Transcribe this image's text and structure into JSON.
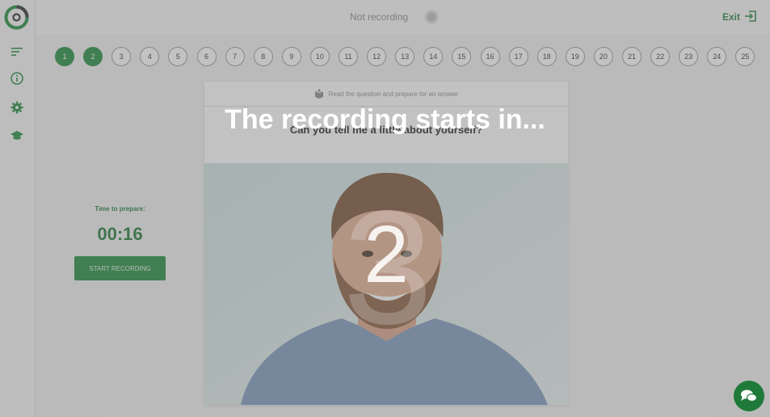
{
  "topbar": {
    "status": "Not recording",
    "exit_label": "Exit"
  },
  "sidebar": {
    "items": [
      {
        "icon": "menu-lines-icon"
      },
      {
        "icon": "info-icon"
      },
      {
        "icon": "gear-icon"
      },
      {
        "icon": "graduation-cap-icon"
      }
    ]
  },
  "steps": {
    "labels": [
      "1",
      "2",
      "3",
      "4",
      "5",
      "6",
      "7",
      "8",
      "9",
      "10",
      "11",
      "12",
      "13",
      "14",
      "15",
      "16",
      "17",
      "18",
      "19",
      "20",
      "21",
      "22",
      "23",
      "24",
      "25"
    ],
    "completed_count": 2
  },
  "prepare": {
    "label": "Time to prepare:",
    "time": "00:16",
    "button": "START RECORDING"
  },
  "card": {
    "hint": "Read the question and prepare for an answer",
    "question": "Can you tell me a little about yourself?"
  },
  "overlay": {
    "title": "The recording starts in...",
    "countdown_prev": "3",
    "countdown": "2"
  },
  "colors": {
    "accent": "#1f8c3d"
  }
}
